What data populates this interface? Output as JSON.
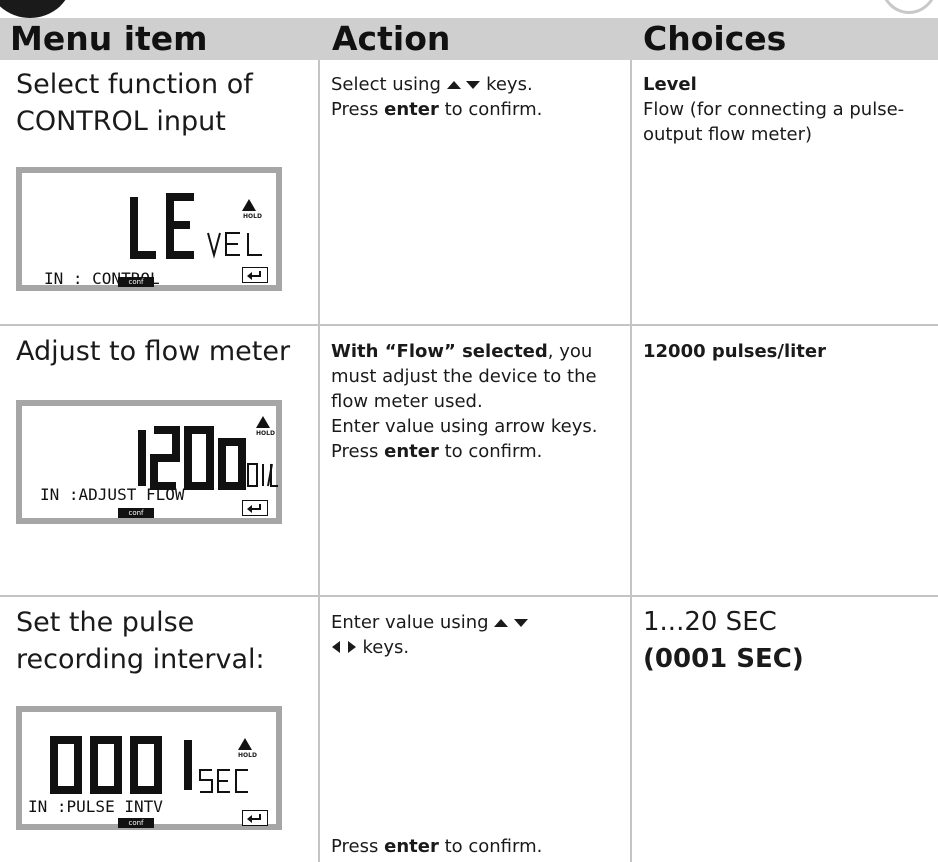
{
  "header": {
    "menu_item": "Menu item",
    "action": "Action",
    "choices": "Choices"
  },
  "rows": [
    {
      "menu_item": "Select function of CONTROL input",
      "action_a": "Select using",
      "action_b": "keys.",
      "action_c": "Press",
      "action_d": "enter",
      "action_e": "to confirm.",
      "choice_main": "Level",
      "choice_sub": "Flow (for connecting a pulse-output flow meter)",
      "lcd": {
        "main": "LE",
        "small": "VEL",
        "bottom": "IN : CONTROL",
        "conf": "conf",
        "hold": "HOLD"
      }
    },
    {
      "menu_item": "Adjust to flow meter",
      "action_bold": "With “Flow” selected",
      "action_rest": ", you must adjust the device to the flow meter used.",
      "action_2": "Enter value using arrow keys.",
      "action_3a": "Press",
      "action_3b": "enter",
      "action_3c": "to confirm.",
      "choice_main": "12000 pulses/liter",
      "lcd": {
        "main": "1200",
        "small": "0 I/L",
        "bottom": "IN :ADJUST FLOW",
        "conf": "conf",
        "hold": "HOLD"
      }
    },
    {
      "menu_item_1": "Set the pulse",
      "menu_item_2": "recording interval:",
      "action_a": "Enter value using",
      "action_b": "keys.",
      "action_c": "Press",
      "action_d": "enter",
      "action_e": "to confirm.",
      "choice_main": "1...20 SEC",
      "choice_default": "(0001 SEC)",
      "lcd": {
        "main": "000 1",
        "small": "SEC",
        "bottom": "IN :PULSE  INTV",
        "conf": "conf",
        "hold": "HOLD"
      }
    }
  ],
  "colors": {
    "header_bg": "#cfcfcf",
    "lcd_frame": "#a6a6a6",
    "grid": "#c4c4c4"
  }
}
